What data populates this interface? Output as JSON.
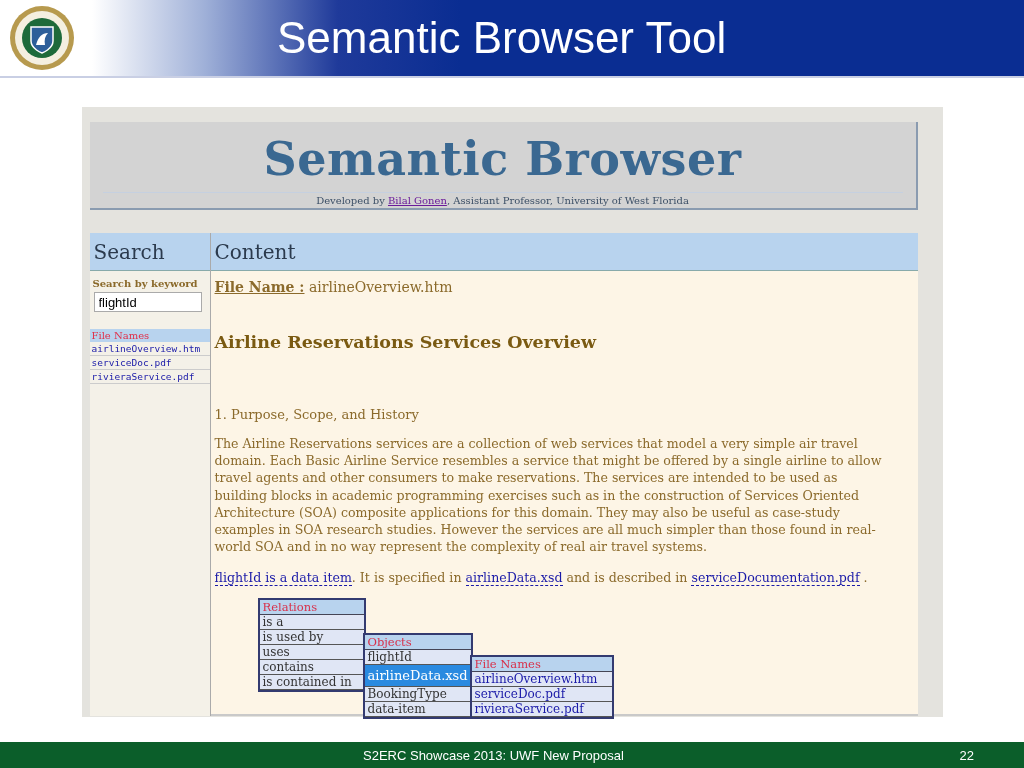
{
  "slide": {
    "title": "Semantic Browser Tool",
    "footer": "S2ERC Showcase 2013: UWF New Proposal",
    "page_number": "22"
  },
  "browser": {
    "title": "Semantic Browser",
    "byline": {
      "prefix": "Developed by ",
      "author": "Bilal Gonen",
      "suffix": ", Assistant Professor, University of West Florida"
    }
  },
  "search": {
    "heading": "Search",
    "keyword_label": "Search by keyword",
    "value": "flightId",
    "file_list": {
      "heading": "File Names",
      "items": [
        "airlineOverview.htm",
        "serviceDoc.pdf",
        "rivieraService.pdf"
      ]
    }
  },
  "content": {
    "heading": "Content",
    "file_name_label": "File Name :",
    "file_name": "airlineOverview.htm",
    "article_title": "Airline Reservations Services Overview",
    "section_heading": "1. Purpose, Scope, and History",
    "paragraph": "The Airline Reservations services are a collection of web services that model a very simple air travel domain. Each Basic Airline Service resembles a service that might be offered by a single airline to allow travel agents and other consumers to make reservations. The services are intended to be used as building blocks in academic programming exercises such as in the construction of Services Oriented Architecture (SOA) composite applications for this domain. They may also be useful as case-study examples in SOA research studies. However the services are all much simpler than those found in real-world SOA and in no way represent the complexity of real air travel systems.",
    "sentence": [
      {
        "kind": "link",
        "text": "flightId is a data item"
      },
      {
        "kind": "text",
        "text": ". It is specified in "
      },
      {
        "kind": "link",
        "text": "airlineData.xsd"
      },
      {
        "kind": "text",
        "text": " and is described in "
      },
      {
        "kind": "link",
        "text": "serviceDocumentation.pdf"
      },
      {
        "kind": "text",
        "text": " ."
      }
    ]
  },
  "popups": {
    "relations": {
      "heading": "Relations",
      "items": [
        {
          "label": "is a",
          "selected": false
        },
        {
          "label": "is used by",
          "selected": false
        },
        {
          "label": "uses",
          "selected": false
        },
        {
          "label": "contains",
          "selected": false
        },
        {
          "label": "is contained in",
          "selected": false
        }
      ]
    },
    "objects": {
      "heading": "Objects",
      "items": [
        {
          "label": "flightId",
          "selected": false
        },
        {
          "label": "airlineData.xsd",
          "selected": true
        },
        {
          "label": "BookingType",
          "selected": false
        },
        {
          "label": "data-item",
          "selected": false
        }
      ]
    },
    "file_names": {
      "heading": "File Names",
      "items": [
        {
          "label": "airlineOverview.htm",
          "selected": false
        },
        {
          "label": "serviceDoc.pdf",
          "selected": false
        },
        {
          "label": "rivieraService.pdf",
          "selected": false
        }
      ]
    }
  }
}
